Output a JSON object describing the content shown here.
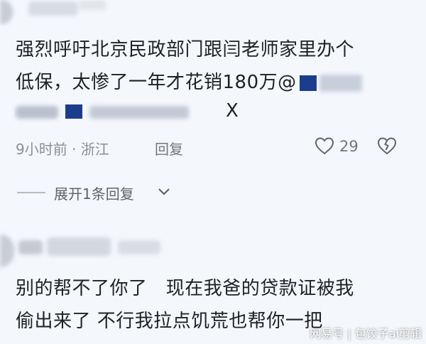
{
  "comment1": {
    "line1": "强烈呼吁北京民政部门跟闫老师家里办个",
    "line2": "低保，太惨了一年才花销180万@",
    "line3_tail": "X",
    "time_location": "9小时前 · 浙江",
    "reply_label": "回复",
    "like_count": "29",
    "like_icon": "heart-outline-icon",
    "dislike_icon": "broken-heart-icon"
  },
  "expand_replies": {
    "label": "展开1条回复",
    "icon": "chevron-down-icon"
  },
  "comment2": {
    "line1": "别的帮不了你了   现在我爸的贷款证被我",
    "line2": "偷出来了 不行我拉点饥荒也帮你一把"
  },
  "watermark": "网易号 | 包饺子ai剪辑",
  "colors": {
    "background": "#f4f7fc",
    "text": "#1f2024",
    "meta": "#8a8f99",
    "redaction": "#1c3d8c"
  }
}
